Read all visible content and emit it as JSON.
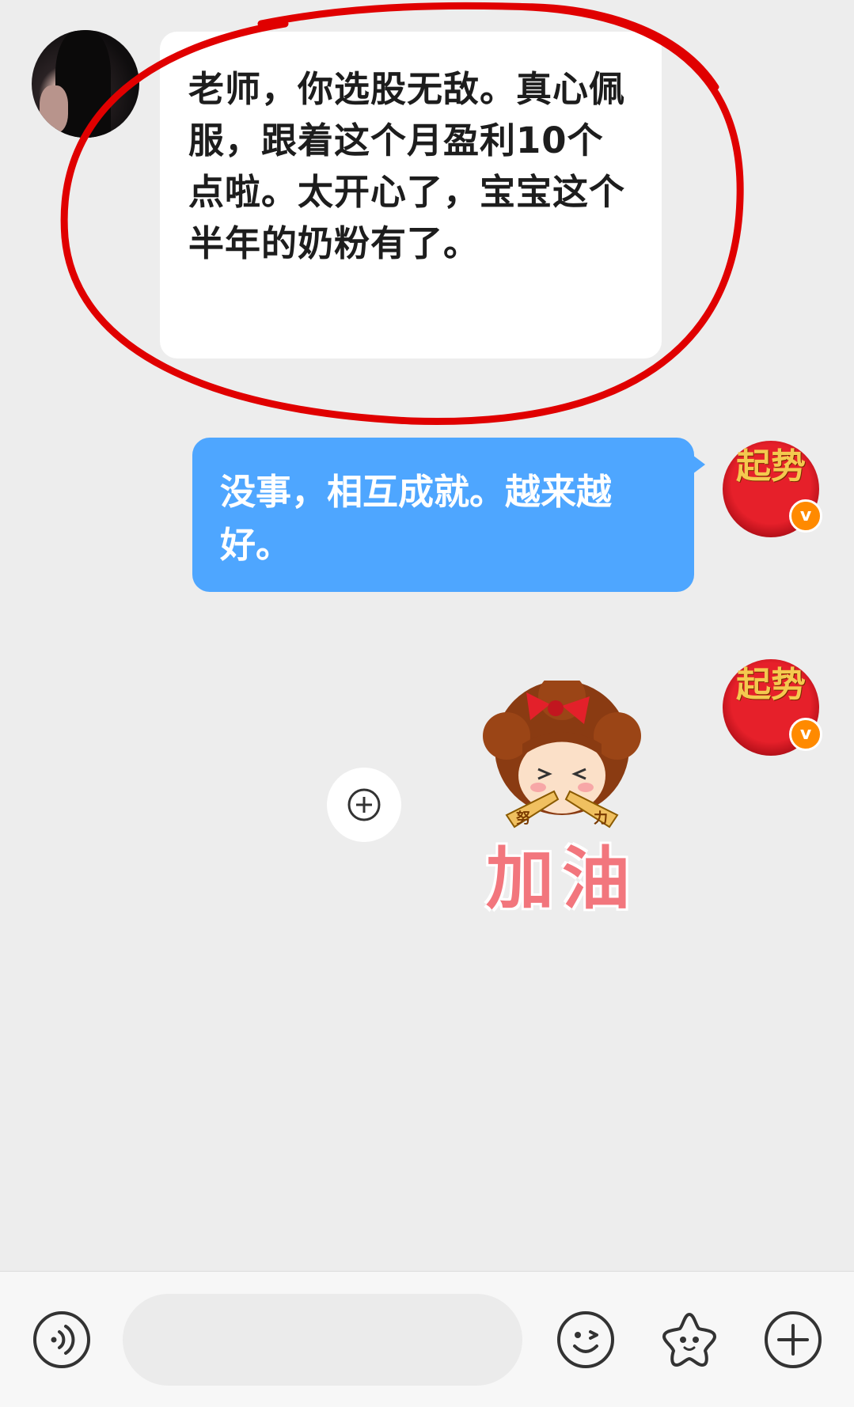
{
  "messages": [
    {
      "side": "left",
      "text": "老师，你选股无敌。真心佩服，跟着这个月盈利10个点啦。太开心了，宝宝这个半年的奶粉有了。"
    },
    {
      "side": "right",
      "text": "没事，相互成就。越来越好。"
    },
    {
      "side": "right",
      "type": "sticker",
      "sticker_caption": "加油",
      "sticker_tag": "努力"
    }
  ],
  "right_avatar": {
    "brand_text": "起势",
    "badge": "v"
  },
  "input_bar": {
    "placeholder": "",
    "value": ""
  },
  "icons": {
    "voice": "voice-icon",
    "emoji": "emoji-icon",
    "sticker": "sticker-icon",
    "more": "plus-icon",
    "add_sticker": "add-sticker-icon"
  },
  "colors": {
    "background": "#ededed",
    "incoming_bubble": "#ffffff",
    "outgoing_bubble": "#4ea6ff",
    "annotation_circle": "#e00000",
    "badge": "#ff8a00"
  }
}
